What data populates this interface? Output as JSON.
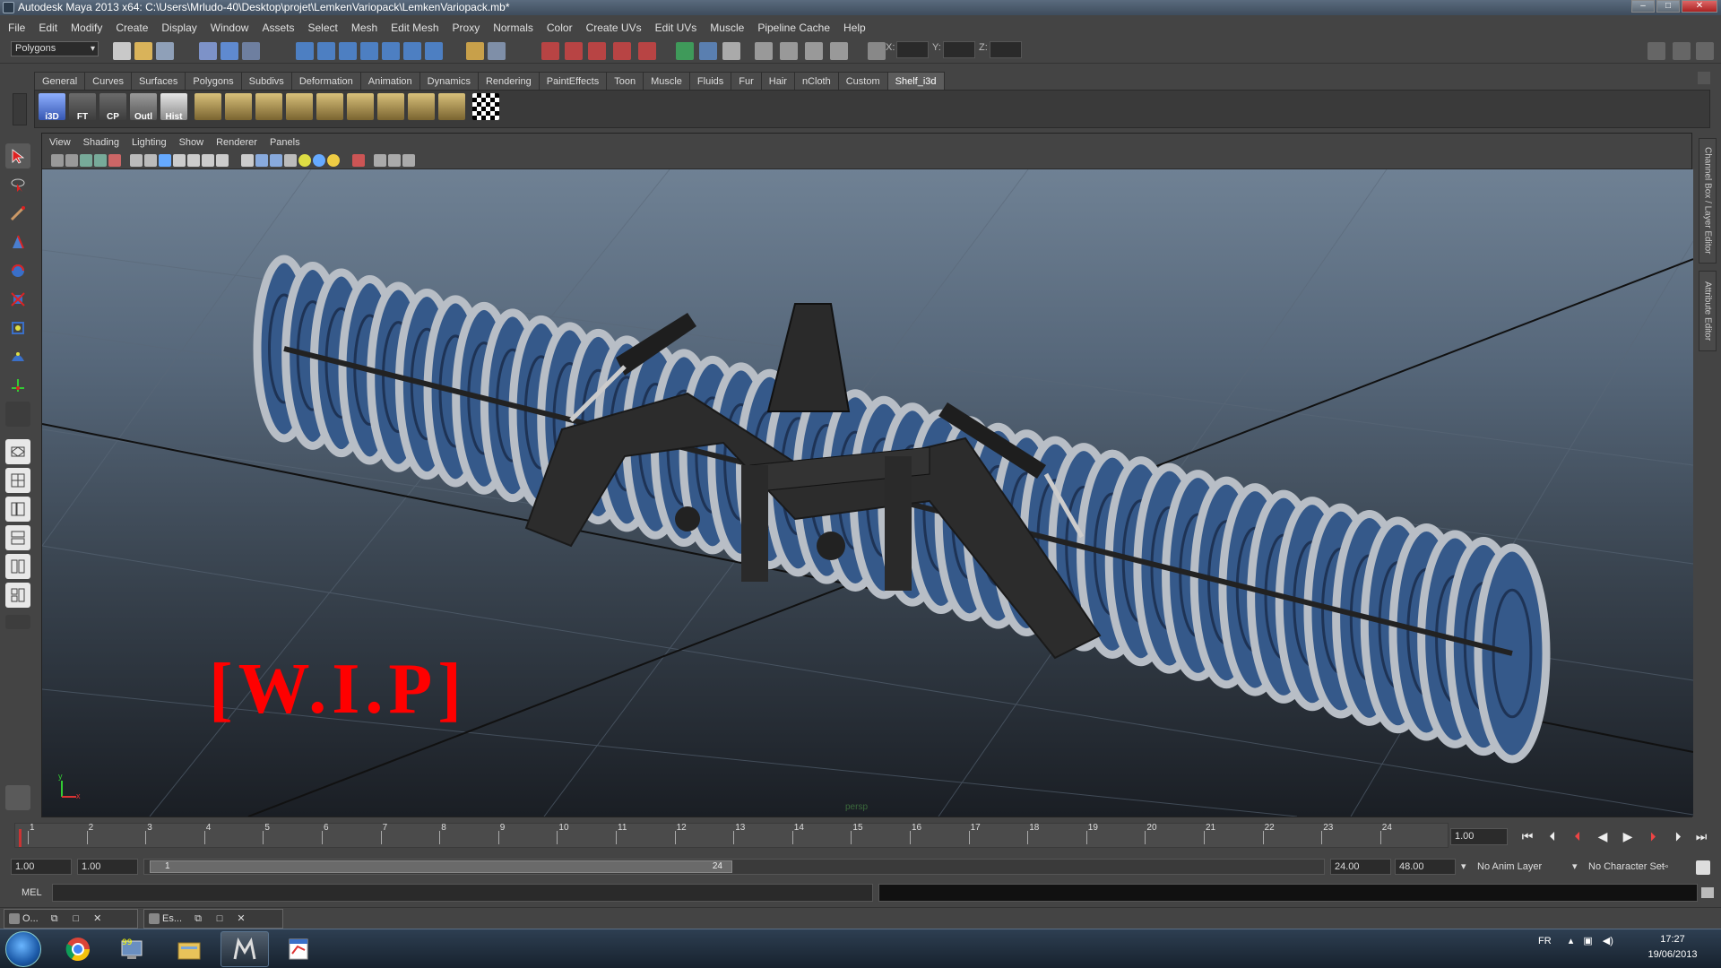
{
  "window": {
    "title": "Autodesk Maya 2013 x64: C:\\Users\\Mrludo-40\\Desktop\\projet\\LemkenVariopack\\LemkenVariopack.mb*"
  },
  "menubar": [
    "File",
    "Edit",
    "Modify",
    "Create",
    "Display",
    "Window",
    "Assets",
    "Select",
    "Mesh",
    "Edit Mesh",
    "Proxy",
    "Normals",
    "Color",
    "Create UVs",
    "Edit UVs",
    "Muscle",
    "Pipeline Cache",
    "Help"
  ],
  "statusline": {
    "mode": "Polygons",
    "x_label": "X:",
    "y_label": "Y:",
    "z_label": "Z:"
  },
  "shelf": {
    "tabs": [
      "General",
      "Curves",
      "Surfaces",
      "Polygons",
      "Subdivs",
      "Deformation",
      "Animation",
      "Dynamics",
      "Rendering",
      "PaintEffects",
      "Toon",
      "Muscle",
      "Fluids",
      "Fur",
      "Hair",
      "nCloth",
      "Custom",
      "Shelf_i3d"
    ],
    "active_tab": "Shelf_i3d",
    "buttons": [
      "i3D",
      "FT",
      "CP",
      "Outl",
      "Hist"
    ]
  },
  "panel": {
    "menus": [
      "View",
      "Shading",
      "Lighting",
      "Show",
      "Renderer",
      "Panels"
    ],
    "camera": "persp",
    "axis_y": "y",
    "axis_x": "x",
    "overlay_text": "[W.I.P]"
  },
  "right_tabs": [
    "Channel Box / Layer Editor",
    "Attribute Editor"
  ],
  "timeline": {
    "ticks": [
      "1",
      "2",
      "3",
      "4",
      "5",
      "6",
      "7",
      "8",
      "9",
      "10",
      "11",
      "12",
      "13",
      "14",
      "15",
      "16",
      "17",
      "18",
      "19",
      "20",
      "21",
      "22",
      "23",
      "24"
    ],
    "current_frame": "1.00"
  },
  "range": {
    "start": "1.00",
    "playback_start": "1.00",
    "slider_start": "1",
    "slider_end": "24",
    "playback_end": "24.00",
    "end": "48.00",
    "anim_layer": "No Anim Layer",
    "character_set": "No Character Set"
  },
  "command": {
    "label": "MEL"
  },
  "mini_windows": [
    {
      "label": "O..."
    },
    {
      "label": "Es..."
    }
  ],
  "taskbar": {
    "lang": "FR",
    "time": "17:27",
    "date": "19/06/2013"
  }
}
